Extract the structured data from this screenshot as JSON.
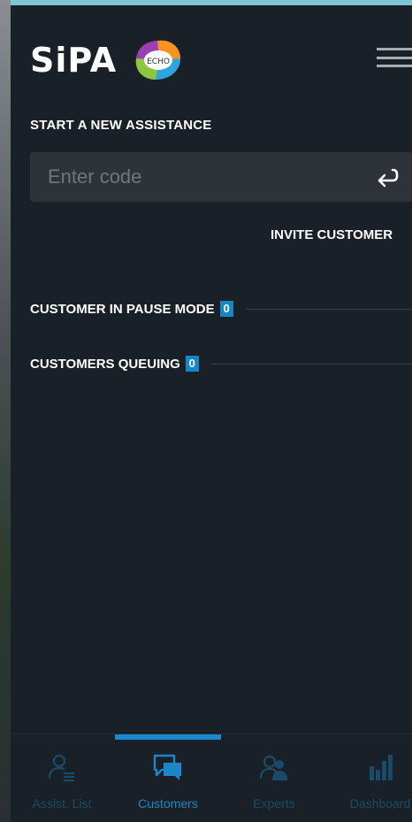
{
  "header": {
    "logo_text": "SiPA",
    "badge_text": "ECHO"
  },
  "assistance": {
    "title": "START A NEW ASSISTANCE",
    "code_placeholder": "Enter code",
    "code_value": "",
    "invite_label": "INVITE CUSTOMER"
  },
  "status": {
    "pause_label": "CUSTOMER IN PAUSE MODE",
    "pause_count": "0",
    "queue_label": "CUSTOMERS QUEUING",
    "queue_count": "0"
  },
  "nav": {
    "items": [
      {
        "label": "Assist. List",
        "icon": "user-list-icon",
        "active": false
      },
      {
        "label": "Customers",
        "icon": "chat-icon",
        "active": true
      },
      {
        "label": "Experts",
        "icon": "users-icon",
        "active": false
      },
      {
        "label": "Dashboard",
        "icon": "bar-chart-icon",
        "active": false
      }
    ]
  },
  "colors": {
    "background": "#192027",
    "accent": "#1a8ad0",
    "field": "#2d3339",
    "nav_dim": "#1b4a69"
  }
}
